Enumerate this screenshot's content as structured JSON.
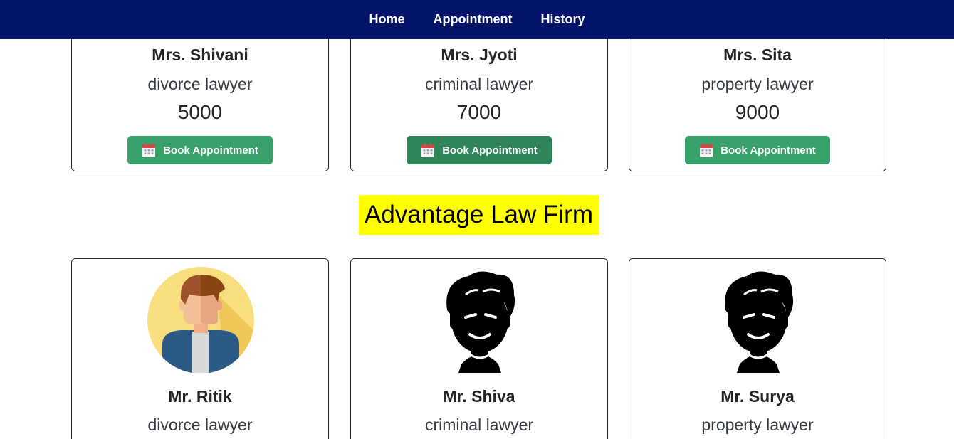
{
  "nav": {
    "items": [
      {
        "label": "Home"
      },
      {
        "label": "Appointment"
      },
      {
        "label": "History"
      }
    ]
  },
  "lawyers_top": [
    {
      "name": "Mrs. Shivani",
      "specialty": "divorce lawyer",
      "fee": "5000",
      "button": "Book Appointment"
    },
    {
      "name": "Mrs. Jyoti",
      "specialty": "criminal lawyer",
      "fee": "7000",
      "button": "Book Appointment"
    },
    {
      "name": "Mrs. Sita",
      "specialty": "property lawyer",
      "fee": "9000",
      "button": "Book Appointment"
    }
  ],
  "firm": {
    "title": "Advantage Law Firm",
    "highlight_color": "#ffff00"
  },
  "lawyers_bottom": [
    {
      "name": "Mr. Ritik",
      "specialty": "divorce lawyer",
      "avatar": "male-avatar-colored-icon"
    },
    {
      "name": "Mr. Shiva",
      "specialty": "criminal lawyer",
      "avatar": "male-avatar-silhouette-icon"
    },
    {
      "name": "Mr. Surya",
      "specialty": "property lawyer",
      "avatar": "male-avatar-silhouette-icon"
    }
  ],
  "colors": {
    "navbar": "#03136a",
    "button": "#38a169",
    "button_hover": "#2f855a"
  }
}
